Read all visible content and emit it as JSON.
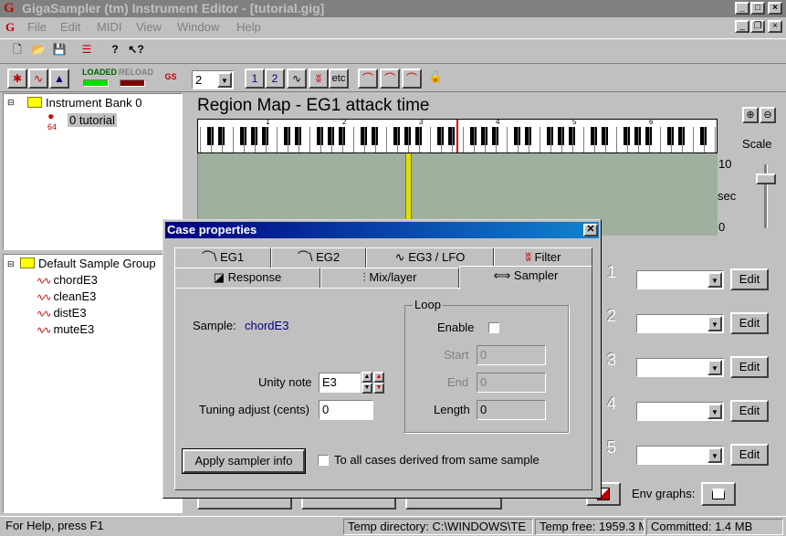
{
  "app": {
    "title": "GigaSampler (tm) Instrument Editor - [tutorial.gig]",
    "icon_letter": "G"
  },
  "menu": [
    "File",
    "Edit",
    "MIDI",
    "View",
    "Window",
    "Help"
  ],
  "toolbar2": {
    "loaded_label": "LOADED",
    "reload_label": "RELOAD",
    "gs_label": "GS",
    "channel_value": "2",
    "etc_label": "etc"
  },
  "instrument_tree": {
    "bank": "Instrument Bank 0",
    "instrument": "0 tutorial",
    "instrument_badge": "64"
  },
  "sample_tree": {
    "group": "Default Sample Group",
    "samples": [
      "chordE3",
      "cleanE3",
      "distE3",
      "muteE3"
    ]
  },
  "region_map": {
    "title": "Region Map - EG1 attack time",
    "octaves": [
      "1",
      "2",
      "3",
      "4",
      "5",
      "6"
    ],
    "y_max": "10",
    "y_unit": "sec",
    "y_min": "0",
    "scale_label": "Scale"
  },
  "cases": {
    "numbers": [
      "1",
      "2",
      "3",
      "4",
      "5"
    ],
    "edit_label": "Edit"
  },
  "env_graphs_label": "Env graphs:",
  "dialog": {
    "title": "Case properties",
    "tabs_row1": [
      "EG1",
      "EG2",
      "EG3 / LFO",
      "Filter"
    ],
    "tabs_row2": [
      "Response",
      "Mix/layer",
      "Sampler"
    ],
    "sample_label": "Sample:",
    "sample_value": "chordE3",
    "unity_note_label": "Unity note",
    "unity_note_value": "E3",
    "tuning_label": "Tuning adjust (cents)",
    "tuning_value": "0",
    "loop": {
      "group_label": "Loop",
      "enable_label": "Enable",
      "start_label": "Start",
      "start_value": "0",
      "end_label": "End",
      "end_value": "0",
      "length_label": "Length",
      "length_value": "0"
    },
    "apply_button": "Apply sampler info",
    "to_all_label": "To all cases derived from same sample"
  },
  "status": {
    "help": "For Help, press F1",
    "temp_dir": "Temp directory: C:\\WINDOWS\\TE",
    "temp_free": "Temp free: 1959.3 M",
    "committed": "Committed: 1.4 MB"
  },
  "colors": {
    "accent_title": "#000080",
    "region_map_bg": "#9fb09f",
    "region_marker": "#e0e000",
    "playhead": "#e00000"
  }
}
